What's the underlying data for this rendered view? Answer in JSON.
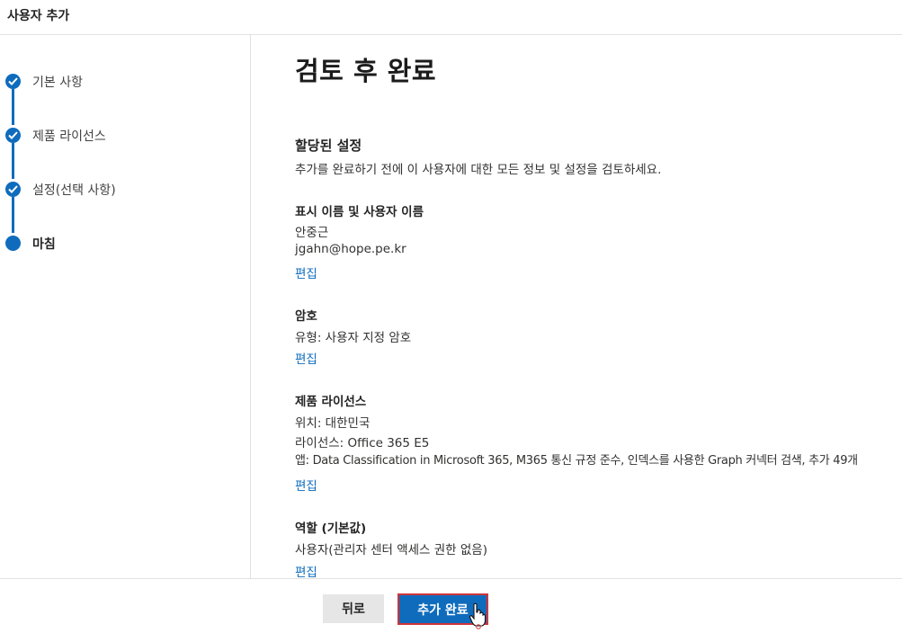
{
  "window": {
    "title": "사용자 추가"
  },
  "steps": [
    {
      "label": "기본 사항",
      "state": "done"
    },
    {
      "label": "제품 라이선스",
      "state": "done"
    },
    {
      "label": "설정(선택 사항)",
      "state": "done"
    },
    {
      "label": "마침",
      "state": "current"
    }
  ],
  "main": {
    "title": "검토 후 완료",
    "assigned": {
      "heading": "할당된 설정",
      "description": "추가를 완료하기 전에 이 사용자에 대한 모든 정보 및 설정을 검토하세요."
    },
    "name_section": {
      "heading": "표시 이름 및 사용자 이름",
      "display_name": "안중근",
      "user_name": "jgahn@hope.pe.kr",
      "edit": "편집"
    },
    "password_section": {
      "heading": "암호",
      "type": "유형: 사용자 지정 암호",
      "edit": "편집"
    },
    "license_section": {
      "heading": "제품 라이선스",
      "location": "위치: 대한민국",
      "license": "라이선스: Office 365 E5",
      "apps": "앱: Data Classification in Microsoft 365, M365 통신 규정 준수, 인덱스를 사용한 Graph 커넥터 검색, 추가 49개",
      "edit": "편집"
    },
    "role_section": {
      "heading": "역할 (기본값)",
      "role": "사용자(관리자 센터 액세스 권한 없음)",
      "edit": "편집"
    }
  },
  "footer": {
    "back": "뒤로",
    "finish": "추가 완료"
  },
  "colors": {
    "accent": "#0f6cbd",
    "highlight": "#d13438"
  },
  "icons": {
    "step_done": "checkmark-icon",
    "cursor": "hand-pointer-icon"
  }
}
